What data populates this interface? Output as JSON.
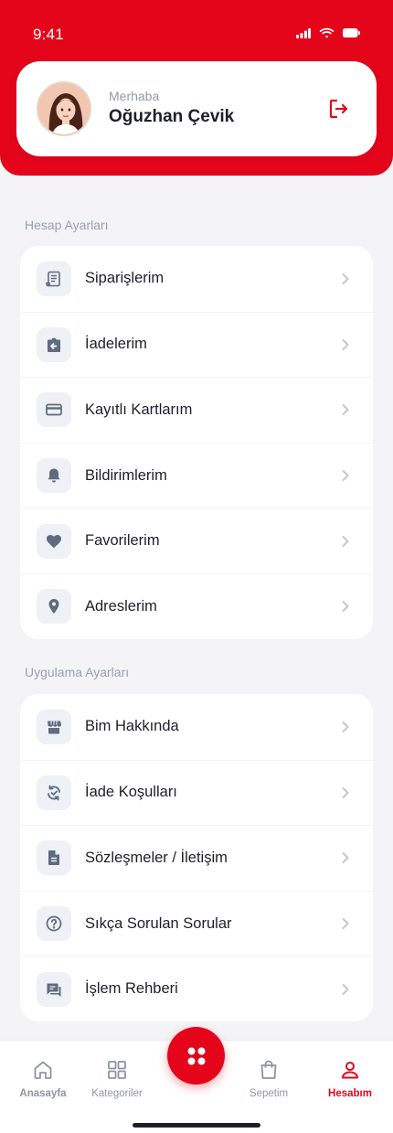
{
  "status_bar": {
    "time": "9:41"
  },
  "profile": {
    "greeting": "Merhaba",
    "name": "Oğuzhan Çevik"
  },
  "account_section": {
    "title": "Hesap Ayarları",
    "items": [
      {
        "label": "Siparişlerim",
        "icon": "receipt-icon"
      },
      {
        "label": "İadelerim",
        "icon": "return-box-icon"
      },
      {
        "label": "Kayıtlı Kartlarım",
        "icon": "credit-card-icon"
      },
      {
        "label": "Bildirimlerim",
        "icon": "bell-icon"
      },
      {
        "label": "Favorilerim",
        "icon": "heart-icon"
      },
      {
        "label": "Adreslerim",
        "icon": "location-pin-icon"
      }
    ]
  },
  "app_section": {
    "title": "Uygulama Ayarları",
    "items": [
      {
        "label": "Bim Hakkında",
        "icon": "store-icon"
      },
      {
        "label": "İade Koşulları",
        "icon": "refresh-check-icon"
      },
      {
        "label": "Sözleşmeler / İletişim",
        "icon": "document-icon"
      },
      {
        "label": "Sıkça Sorulan Sorular",
        "icon": "help-circle-icon"
      },
      {
        "label": "İşlem Rehberi",
        "icon": "chat-icon"
      }
    ]
  },
  "bottom_nav": {
    "items": [
      {
        "label": "Anasayfa",
        "icon": "home-icon"
      },
      {
        "label": "Kategoriler",
        "icon": "grid-icon"
      },
      {
        "label": "Sepetim",
        "icon": "shopping-bag-icon"
      },
      {
        "label": "Hesabım",
        "icon": "user-icon",
        "active": true
      }
    ],
    "center_action_icon": "dots-grid-icon"
  },
  "colors": {
    "brand": "#e4051b",
    "background": "#f4f4f6",
    "icon_bg": "#eef1f5",
    "icon": "#5f6b80"
  }
}
